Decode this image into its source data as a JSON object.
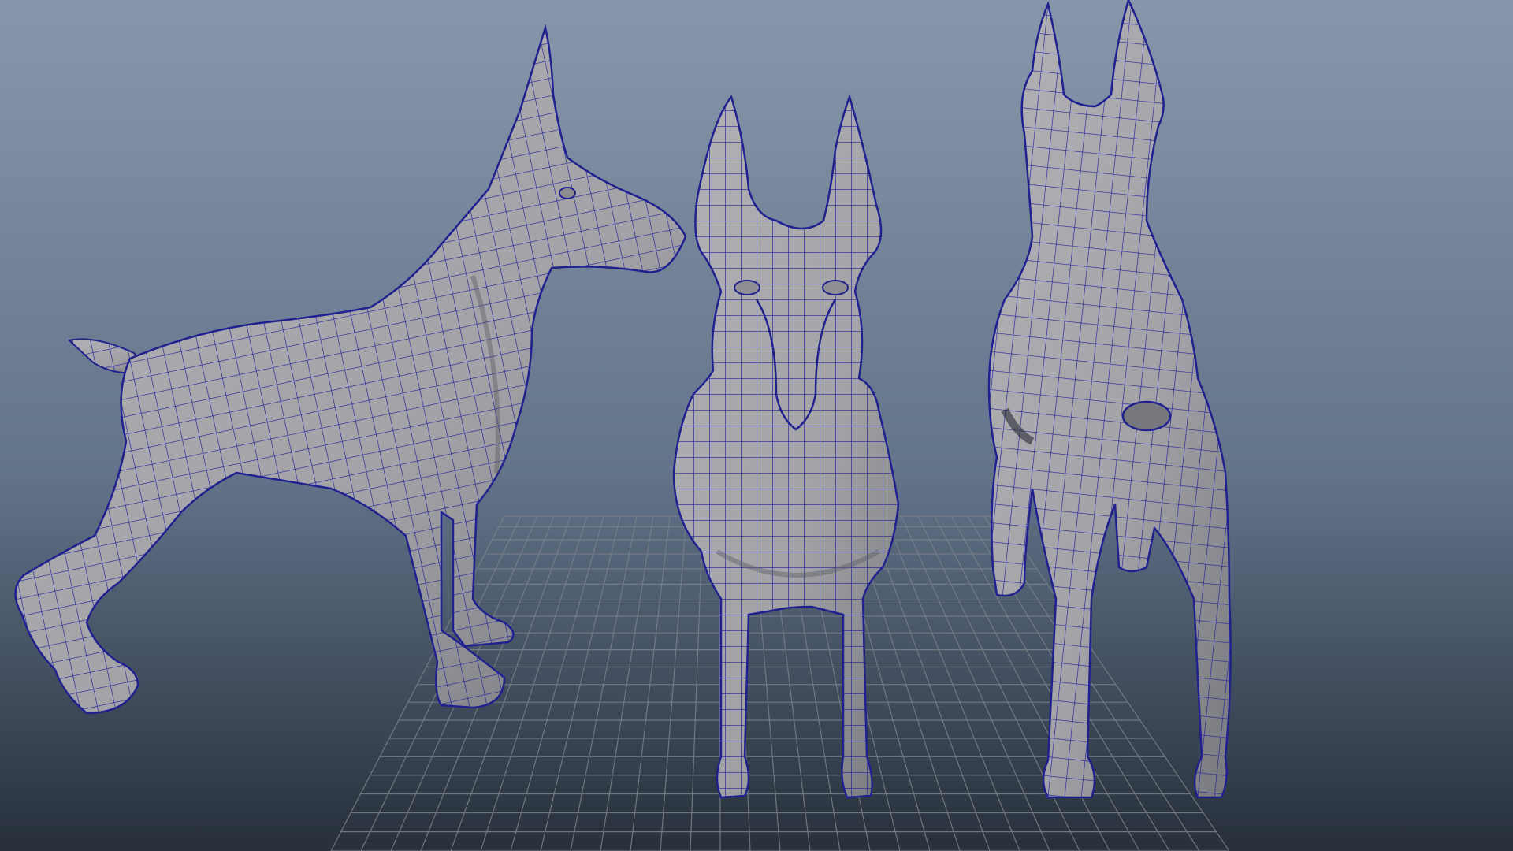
{
  "viewport": {
    "background_top": "#8797ab",
    "background_bottom": "#27303b",
    "grid_color": "#7c818a",
    "mesh_fill": "#a6a6ab",
    "mesh_shadow": "#6f7076",
    "wire_color": "#20208f"
  },
  "models": [
    {
      "view": "side",
      "icon": "doberman-side-mesh"
    },
    {
      "view": "front",
      "icon": "doberman-front-mesh"
    },
    {
      "view": "back",
      "icon": "doberman-back-mesh"
    }
  ]
}
